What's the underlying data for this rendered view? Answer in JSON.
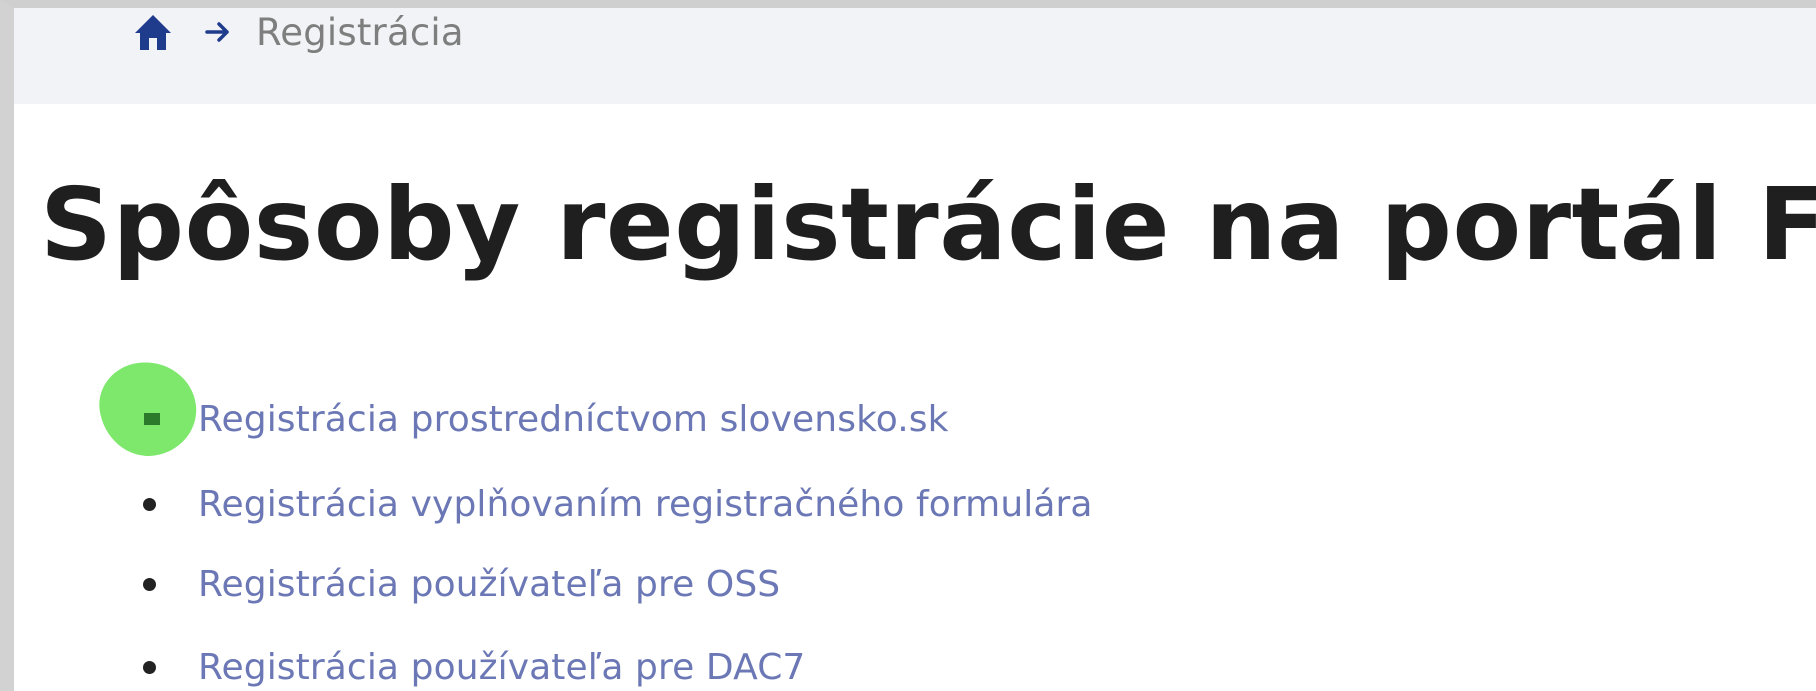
{
  "breadcrumb": {
    "home_icon": "home-icon",
    "separator_icon": "arrow-right-icon",
    "current": "Registrácia"
  },
  "page": {
    "title": "Spôsoby registrácie na portál FS"
  },
  "links": [
    {
      "label": "Registrácia prostredníctvom slovensko.sk",
      "highlighted": true
    },
    {
      "label": "Registrácia vyplňovaním registračného formulára"
    },
    {
      "label": "Registrácia používateľa pre OSS"
    },
    {
      "label": "Registrácia používateľa pre DAC7"
    }
  ],
  "colors": {
    "link": "#6b78b5",
    "title": "#1f1f1f",
    "breadcrumb_bar": "#f2f3f6",
    "home_icon": "#1f3b8c",
    "highlight": "#7de86c"
  }
}
